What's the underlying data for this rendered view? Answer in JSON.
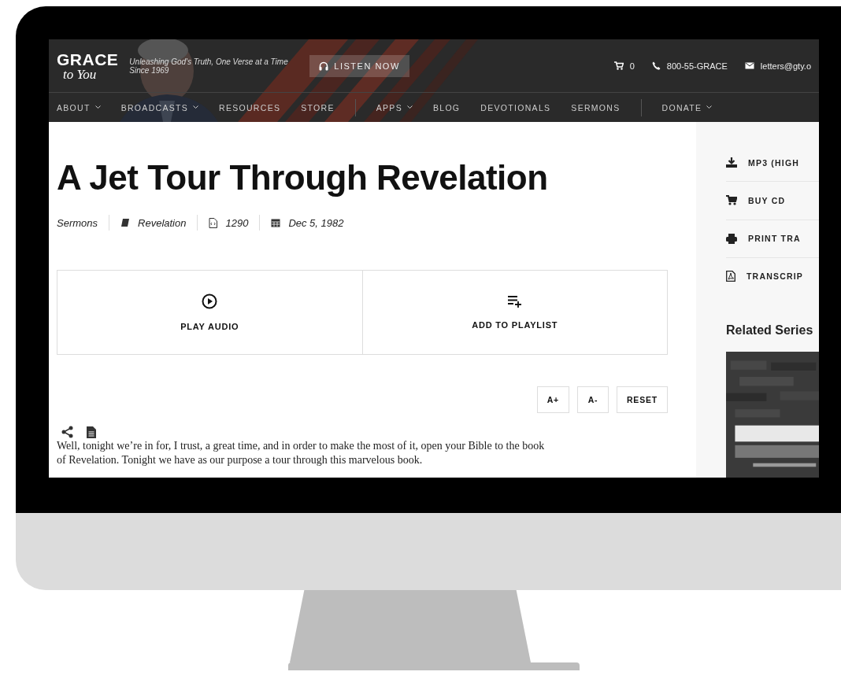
{
  "header": {
    "logo": {
      "line1": "GRACE",
      "line2": "to You"
    },
    "tagline": "Unleashing God's Truth, One Verse at a Time",
    "since": "Since 1969",
    "listen_button": "LISTEN NOW",
    "utility": [
      {
        "kind": "cart",
        "label": "0"
      },
      {
        "kind": "phone",
        "label": "800-55-GRACE"
      },
      {
        "kind": "mail",
        "label": "letters@gty.o"
      }
    ]
  },
  "nav": [
    {
      "label": "ABOUT",
      "has_menu": true,
      "divider_before": false
    },
    {
      "label": "BROADCASTS",
      "has_menu": true,
      "divider_before": false
    },
    {
      "label": "RESOURCES",
      "has_menu": false,
      "divider_before": false
    },
    {
      "label": "STORE",
      "has_menu": false,
      "divider_before": false
    },
    {
      "label": "APPS",
      "has_menu": true,
      "divider_before": true
    },
    {
      "label": "BLOG",
      "has_menu": false,
      "divider_before": false
    },
    {
      "label": "DEVOTIONALS",
      "has_menu": false,
      "divider_before": false
    },
    {
      "label": "SERMONS",
      "has_menu": false,
      "divider_before": false
    },
    {
      "label": "DONATE",
      "has_menu": true,
      "divider_before": true
    }
  ],
  "article": {
    "title": "A Jet Tour Through Revelation",
    "meta": [
      {
        "kind": "category",
        "label": "Sermons"
      },
      {
        "kind": "book",
        "label": "Revelation"
      },
      {
        "kind": "code",
        "label": "1290"
      },
      {
        "kind": "date",
        "label": "Dec 5, 1982"
      }
    ],
    "actions": [
      {
        "kind": "play",
        "label": "PLAY AUDIO"
      },
      {
        "kind": "playlist",
        "label": "ADD TO PLAYLIST"
      }
    ],
    "font_buttons": [
      "A+",
      "A-",
      "RESET"
    ],
    "lines": [
      "Well, tonight we’re in for, I trust, a great time, and in order to make the most of it, open your Bible to the book",
      "of Revelation.  Tonight we have as our purpose a tour through this marvelous book."
    ]
  },
  "sidebar": {
    "links": [
      {
        "kind": "download",
        "label": "MP3 (HIGH"
      },
      {
        "kind": "cart",
        "label": "BUY CD"
      },
      {
        "kind": "print",
        "label": "PRINT TRA"
      },
      {
        "kind": "pdf",
        "label": "TRANSCRIP"
      }
    ],
    "related_heading": "Related Series"
  }
}
